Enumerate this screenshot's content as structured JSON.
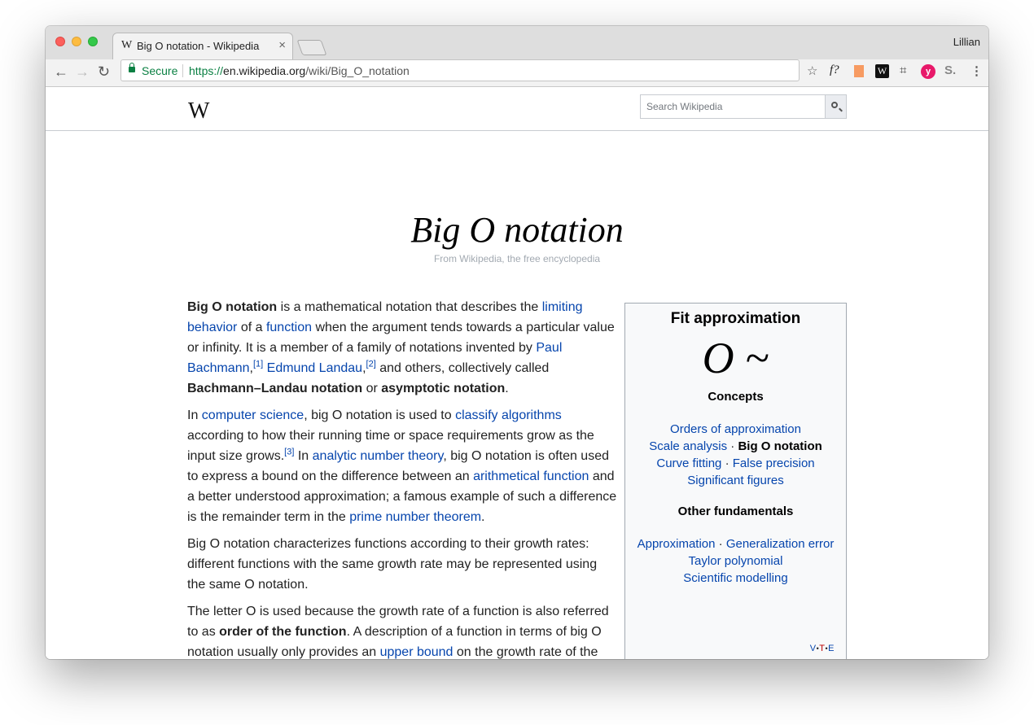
{
  "browser": {
    "tab_favicon": "W",
    "tab_title": "Big O notation - Wikipedia",
    "tab_close": "×",
    "profile_name": "Lillian",
    "secure_label": "Secure",
    "url_scheme": "https://",
    "url_host": "en.wikipedia.org",
    "url_path": "/wiki/Big_O_notation",
    "extensions": [
      "star-icon",
      "f?",
      "bookmark-icon",
      "W",
      "crop-icon",
      "y",
      "S."
    ]
  },
  "header": {
    "logo": "W",
    "search_placeholder": "Search Wikipedia"
  },
  "article": {
    "title": "Big O notation",
    "tagline": "From Wikipedia, the free encyclopedia",
    "p1": {
      "t1": "Big O notation",
      "t2": " is a mathematical notation that describes the ",
      "l1": "limiting behavior",
      "t3": " of a ",
      "l2": "function",
      "t4": " when the argument tends towards a particular value or infinity. It is a member of a family of notations invented by ",
      "l3": "Paul Bachmann",
      "r1": "[1]",
      "t5": " ",
      "l4": "Edmund Landau",
      "r2": "[2]",
      "t6": " and others, collectively called ",
      "b1": "Bachmann–Landau notation",
      "t7": " or ",
      "b2": "asymptotic notation",
      "t8": "."
    },
    "p2": {
      "t1": "In ",
      "l1": "computer science",
      "t2": ", big O notation is used to ",
      "l2": "classify algorithms",
      "t3": " according to how their running time or space requirements grow as the input size grows.",
      "r1": "[3]",
      "t4": " In ",
      "l3": "analytic number theory",
      "t5": ", big O notation is often used to express a bound on the difference between an ",
      "l4": "arithmetical function",
      "t6": " and a better understood approximation; a famous example of such a difference is the remainder term in the ",
      "l5": "prime number theorem",
      "t7": "."
    },
    "p3": "Big O notation characterizes functions according to their growth rates: different functions with the same growth rate may be represented using the same O notation.",
    "p4": {
      "t1": "The letter O is used because the growth rate of a function is also referred to as ",
      "b1": "order of the function",
      "t2": ". A description of a function in terms of big O notation usually only provides an ",
      "l1": "upper bound",
      "t3": " on the growth rate of the"
    }
  },
  "infobox": {
    "title": "Fit approximation",
    "glyph": "O ~",
    "concepts_heading": "Concepts",
    "concepts": {
      "l1": "Orders of approximation",
      "l2": "Scale analysis",
      "current": "Big O notation",
      "l3": "Curve fitting",
      "l4": "False precision",
      "l5": "Significant figures"
    },
    "other_heading": "Other fundamentals",
    "other": {
      "l1": "Approximation",
      "l2": "Generalization error",
      "l3": "Taylor polynomial",
      "l4": "Scientific modelling"
    },
    "separator": " · ",
    "vte": {
      "v": "V",
      "t": "T",
      "e": "E",
      "dot": "•"
    }
  }
}
